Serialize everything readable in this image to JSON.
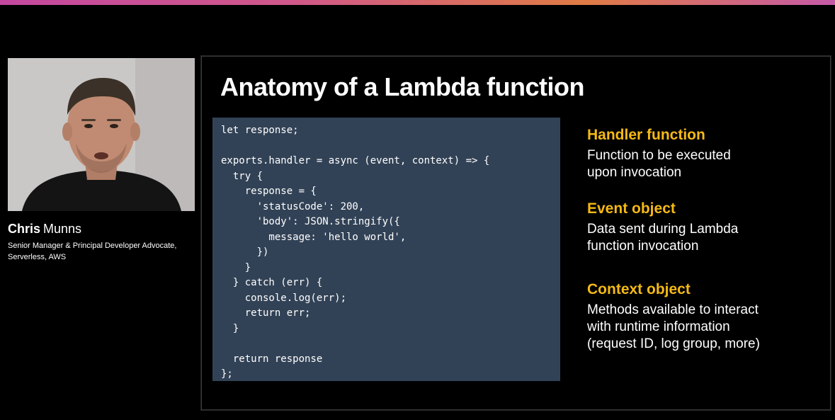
{
  "colors": {
    "accent_yellow": "#f5b916",
    "code_background": "#324256",
    "background": "#000000",
    "text": "#ffffff"
  },
  "speaker": {
    "first_name": "Chris",
    "last_name": "Munns",
    "title": "Senior Manager & Principal Developer Advocate, Serverless, AWS"
  },
  "slide": {
    "title": "Anatomy of a Lambda function",
    "code": "let response;\n\nexports.handler = async (event, context) => {\n  try {\n    response = {\n      'statusCode': 200,\n      'body': JSON.stringify({\n        message: 'hello world',\n      })\n    }\n  } catch (err) {\n    console.log(err);\n    return err;\n  }\n\n  return response\n};",
    "features": [
      {
        "title": "Handler function",
        "description": "Function to be executed\nupon invocation"
      },
      {
        "title": "Event object",
        "description": "Data sent during Lambda\nfunction invocation"
      },
      {
        "title": "Context object",
        "description": "Methods available to interact\nwith runtime information\n(request ID, log group, more)"
      }
    ]
  }
}
